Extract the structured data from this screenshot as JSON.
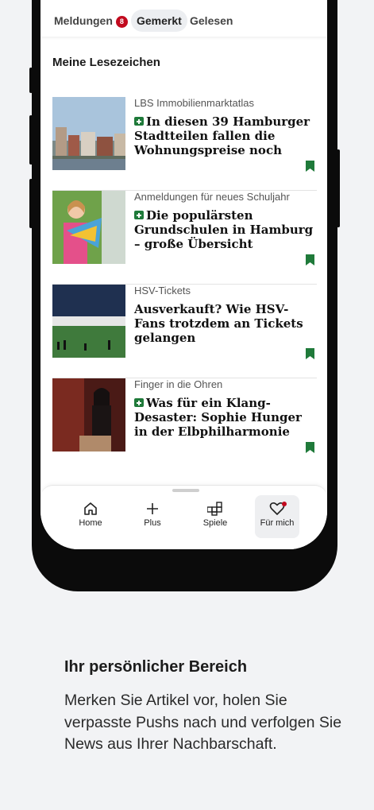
{
  "tabs": {
    "meldungen": "Meldungen",
    "meldungen_badge": "8",
    "gemerkt": "Gemerkt",
    "gelesen": "Gelesen"
  },
  "section_title": "Meine Lesezeichen",
  "articles": [
    {
      "kicker": "LBS Immobilienmarktatlas",
      "plus": true,
      "headline": "In diesen 39 Hamburger Stadtteilen fallen die Wohnungspreise noch"
    },
    {
      "kicker": "Anmeldungen für neues Schuljahr",
      "plus": true,
      "headline": "Die populärsten Grundschulen in Hamburg – große Übersicht"
    },
    {
      "kicker": "HSV-Tickets",
      "plus": false,
      "headline": "Ausverkauft? Wie HSV-Fans trotzdem an Tickets gelangen"
    },
    {
      "kicker": "Finger in die Ohren",
      "plus": true,
      "headline": "Was für ein Klang-Desaster: Sophie Hunger in der Elbphilharmonie"
    }
  ],
  "nav": {
    "home": "Home",
    "plus": "Plus",
    "spiele": "Spiele",
    "fuer_mich": "Für mich"
  },
  "promo": {
    "title": "Ihr persönlicher Bereich",
    "body": "Merken Sie Artikel vor, holen Sie verpasste Pushs nach und verfolgen Sie News aus Ihrer Nachbarschaft."
  },
  "colors": {
    "accent_red": "#c20a1e",
    "plus_green": "#1f7a3a",
    "bookmark_green": "#1f7a3a"
  }
}
